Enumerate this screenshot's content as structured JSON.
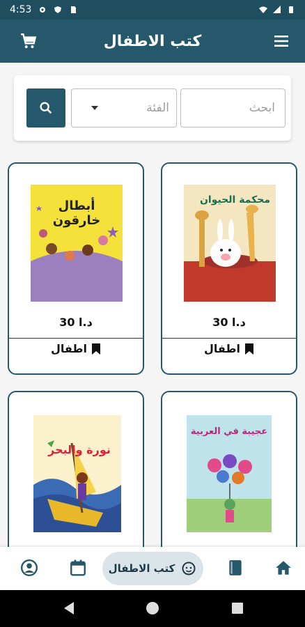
{
  "status_bar": {
    "time": "4:53"
  },
  "app_bar": {
    "title": "كتب الاطفال"
  },
  "search": {
    "query_placeholder": "ابحث",
    "category_placeholder": "الفئة"
  },
  "books": [
    {
      "title": "محكمة الحيوان",
      "price": "30 د.ا",
      "category": "اطفال"
    },
    {
      "title": "أبطال خارقون",
      "price": "30 د.ا",
      "category": "اطفال"
    },
    {
      "title": "عجيبة في العربية",
      "price": "",
      "category": ""
    },
    {
      "title": "نورة والبحر",
      "price": "",
      "category": ""
    }
  ],
  "bottom_nav": {
    "active_label": "كتب الاطفال"
  },
  "colors": {
    "primary": "#25586a",
    "status": "#1f4f5f",
    "pill": "#dbe5e9"
  }
}
